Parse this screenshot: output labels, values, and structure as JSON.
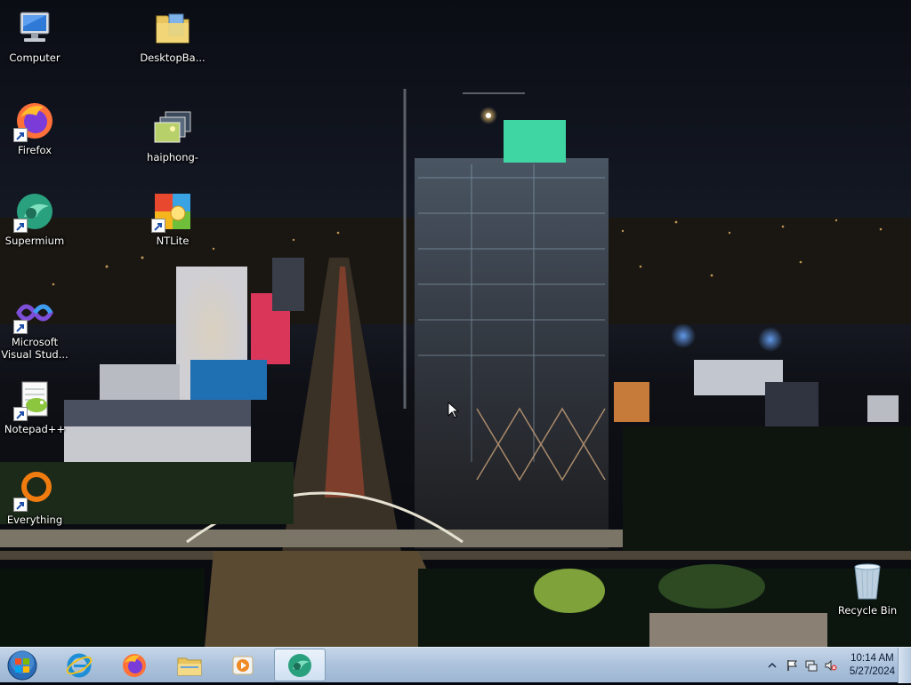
{
  "desktop": {
    "icons": [
      {
        "id": "computer",
        "label": "Computer",
        "icon": "computer-icon"
      },
      {
        "id": "firefox",
        "label": "Firefox",
        "icon": "firefox-icon"
      },
      {
        "id": "supermium",
        "label": "Supermium",
        "icon": "supermium-icon"
      },
      {
        "id": "vs",
        "label": "Microsoft Visual Stud...",
        "icon": "visual-studio-icon"
      },
      {
        "id": "notepad",
        "label": "Notepad++",
        "icon": "notepad-plus-plus-icon"
      },
      {
        "id": "everything",
        "label": "Everything",
        "icon": "everything-search-icon"
      },
      {
        "id": "desktopba",
        "label": "DesktopBa...",
        "icon": "folder-icon"
      },
      {
        "id": "haiphong",
        "label": "haiphong-",
        "icon": "image-file-icon"
      },
      {
        "id": "ntlite",
        "label": "NTLite",
        "icon": "ntlite-icon"
      },
      {
        "id": "recycle",
        "label": "Recycle Bin",
        "icon": "recycle-bin-icon"
      }
    ]
  },
  "taskbar": {
    "start": "windows-start-orb",
    "pinned": [
      {
        "id": "ie",
        "icon": "internet-explorer-icon"
      },
      {
        "id": "firefox",
        "icon": "firefox-icon"
      },
      {
        "id": "explorer",
        "icon": "file-explorer-icon"
      },
      {
        "id": "media",
        "icon": "media-player-icon"
      },
      {
        "id": "supermium",
        "icon": "supermium-icon",
        "active": true
      }
    ],
    "tray": {
      "icons": [
        "show-hidden-icons-arrow",
        "action-center-flag-icon",
        "network-icon",
        "volume-muted-icon"
      ],
      "time": "10:14 AM",
      "date": "5/27/2024"
    }
  },
  "colors": {
    "taskbar": "#aec4dd",
    "desktop_label": "#ffffff"
  }
}
